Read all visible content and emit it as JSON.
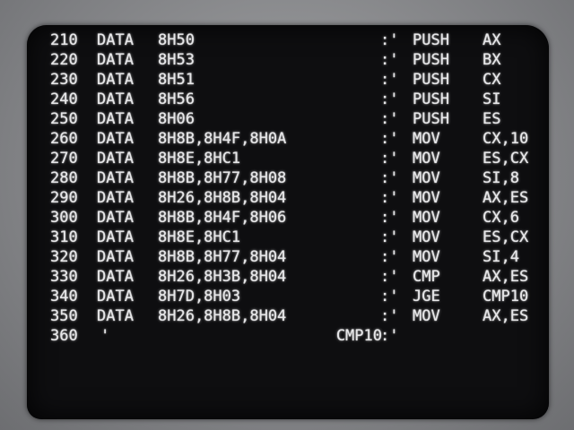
{
  "lines": [
    {
      "num": "210",
      "kw": "DATA",
      "vals": "8H50",
      "label": "",
      "sep": ":'",
      "op": "PUSH",
      "args": "AX"
    },
    {
      "num": "220",
      "kw": "DATA",
      "vals": "8H53",
      "label": "",
      "sep": ":'",
      "op": "PUSH",
      "args": "BX"
    },
    {
      "num": "230",
      "kw": "DATA",
      "vals": "8H51",
      "label": "",
      "sep": ":'",
      "op": "PUSH",
      "args": "CX"
    },
    {
      "num": "240",
      "kw": "DATA",
      "vals": "8H56",
      "label": "",
      "sep": ":'",
      "op": "PUSH",
      "args": "SI"
    },
    {
      "num": "250",
      "kw": "DATA",
      "vals": "8H06",
      "label": "",
      "sep": ":'",
      "op": "PUSH",
      "args": "ES"
    },
    {
      "num": "260",
      "kw": "DATA",
      "vals": "8H8B,8H4F,8H0A",
      "label": "",
      "sep": ":'",
      "op": "MOV",
      "args": "CX,10"
    },
    {
      "num": "270",
      "kw": "DATA",
      "vals": "8H8E,8HC1",
      "label": "",
      "sep": ":'",
      "op": "MOV",
      "args": "ES,CX"
    },
    {
      "num": "280",
      "kw": "DATA",
      "vals": "8H8B,8H77,8H08",
      "label": "",
      "sep": ":'",
      "op": "MOV",
      "args": "SI,8"
    },
    {
      "num": "290",
      "kw": "DATA",
      "vals": "8H26,8H8B,8H04",
      "label": "",
      "sep": ":'",
      "op": "MOV",
      "args": "AX,ES"
    },
    {
      "num": "300",
      "kw": "DATA",
      "vals": "8H8B,8H4F,8H06",
      "label": "",
      "sep": ":'",
      "op": "MOV",
      "args": "CX,6"
    },
    {
      "num": "310",
      "kw": "DATA",
      "vals": "8H8E,8HC1",
      "label": "",
      "sep": ":'",
      "op": "MOV",
      "args": "ES,CX"
    },
    {
      "num": "320",
      "kw": "DATA",
      "vals": "8H8B,8H77,8H04",
      "label": "",
      "sep": ":'",
      "op": "MOV",
      "args": "SI,4"
    },
    {
      "num": "330",
      "kw": "DATA",
      "vals": "8H26,8H3B,8H04",
      "label": "",
      "sep": ":'",
      "op": "CMP",
      "args": "AX,ES"
    },
    {
      "num": "340",
      "kw": "DATA",
      "vals": "8H7D,8H03",
      "label": "",
      "sep": ":'",
      "op": "JGE",
      "args": "CMP10"
    },
    {
      "num": "350",
      "kw": "DATA",
      "vals": "8H26,8H8B,8H04",
      "label": "",
      "sep": ":'",
      "op": "MOV",
      "args": "AX,ES"
    }
  ],
  "last_line": {
    "num": "360",
    "quote": "'",
    "label": "CMP10",
    "sep": ":'"
  }
}
